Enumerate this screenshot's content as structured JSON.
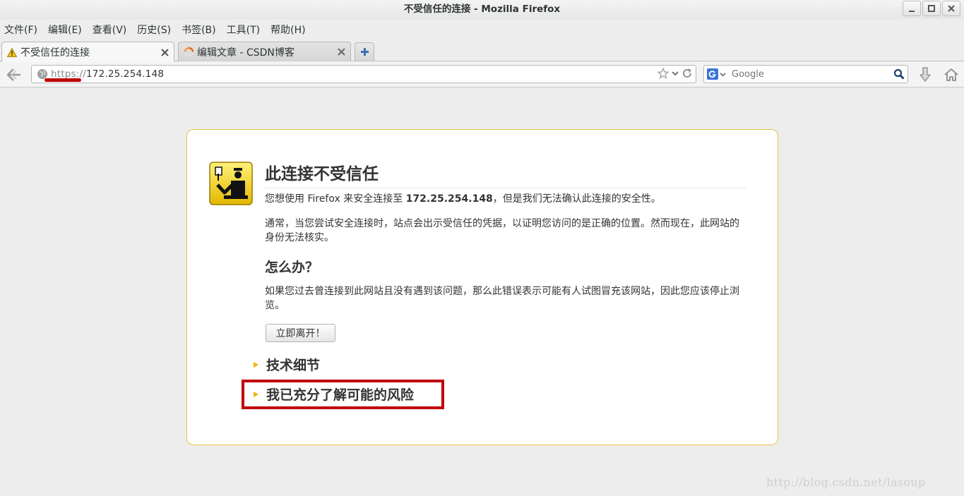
{
  "window": {
    "title": "不受信任的连接 - Mozilla Firefox"
  },
  "menubar": {
    "items": [
      "文件(F)",
      "编辑(E)",
      "查看(V)",
      "历史(S)",
      "书签(B)",
      "工具(T)",
      "帮助(H)"
    ]
  },
  "tabs": [
    {
      "label": "不受信任的连接",
      "icon": "warning-icon",
      "active": true
    },
    {
      "label": "编辑文章 - CSDN博客",
      "icon": "loading-icon",
      "active": false
    }
  ],
  "navbar": {
    "url_scheme": "https://",
    "url_host": "172.25.254.148",
    "search_placeholder": "Google"
  },
  "error_page": {
    "title": "此连接不受信任",
    "intro_before": "您想使用 Firefox 来安全连接至 ",
    "intro_host": "172.25.254.148",
    "intro_after": "，但是我们无法确认此连接的安全性。",
    "explanation": "通常，当您尝试安全连接时，站点会出示受信任的凭据，以证明您访问的是正确的位置。然而现在，此网站的身份无法核实。",
    "what_to_do_heading": "怎么办？",
    "what_to_do_text": "如果您过去曾连接到此网站且没有遇到该问题，那么此错误表示可能有人试图冒充该网站，因此您应该停止浏览。",
    "leave_button": "立即离开！",
    "technical_details": "技术细节",
    "understand_risks": "我已充分了解可能的风险"
  },
  "watermark": "http://blog.csdn.net/lasoup",
  "colors": {
    "box_border": "#e5c440",
    "highlight": "#c0000a",
    "triangle": "#f0b400"
  }
}
